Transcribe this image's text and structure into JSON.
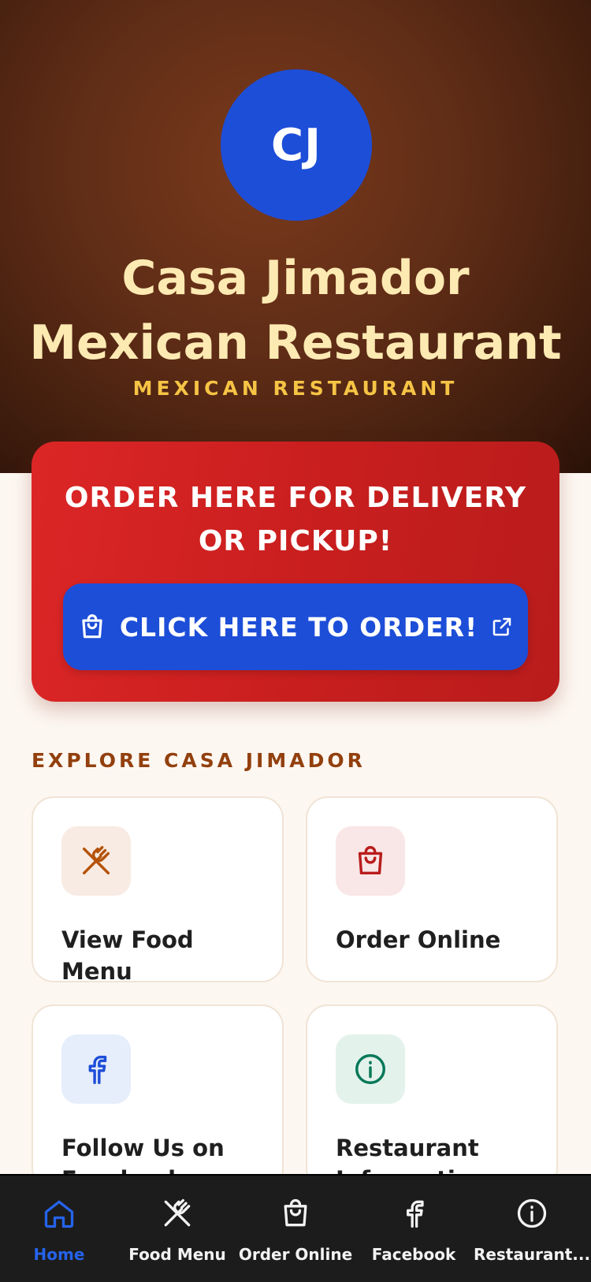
{
  "hero": {
    "initials": "CJ",
    "title_line1": "Casa Jimador",
    "title_line2": "Mexican Restaurant",
    "subtitle": "MEXICAN RESTAURANT"
  },
  "order_card": {
    "heading_line1": "ORDER HERE FOR DELIVERY",
    "heading_line2": "OR PICKUP!",
    "button_label": "CLICK HERE TO ORDER!",
    "button_icon": "shopping-bag-icon",
    "external_icon": "external-link-icon"
  },
  "explore": {
    "heading": "EXPLORE CASA JIMADOR",
    "cards": [
      {
        "label": "View Food Menu",
        "icon": "utensils-icon",
        "icon_color": "#b45309",
        "icon_bg": "#f8ebe3"
      },
      {
        "label": "Order Online",
        "icon": "shopping-bag-icon",
        "icon_color": "#b91c1c",
        "icon_bg": "#f9e6e6"
      },
      {
        "label": "Follow Us on Facebook",
        "icon": "facebook-icon",
        "icon_color": "#1d4ed8",
        "icon_bg": "#e6edfb"
      },
      {
        "label": "Restaurant Information",
        "icon": "info-icon",
        "icon_color": "#047857",
        "icon_bg": "#e4f2ec"
      }
    ]
  },
  "nav": {
    "items": [
      {
        "label": "Home",
        "icon": "home-icon",
        "active": true
      },
      {
        "label": "Food Menu",
        "icon": "utensils-icon"
      },
      {
        "label": "Order Online",
        "icon": "shopping-bag-icon"
      },
      {
        "label": "Facebook",
        "icon": "facebook-icon"
      },
      {
        "label": "Restaurant...",
        "icon": "info-icon"
      }
    ]
  },
  "colors": {
    "accent_blue": "#1d4ed8",
    "order_red": "#dc2626",
    "title_cream": "#fdeab3",
    "subtitle_gold": "#f6c445",
    "explore_brown": "#92400e"
  }
}
